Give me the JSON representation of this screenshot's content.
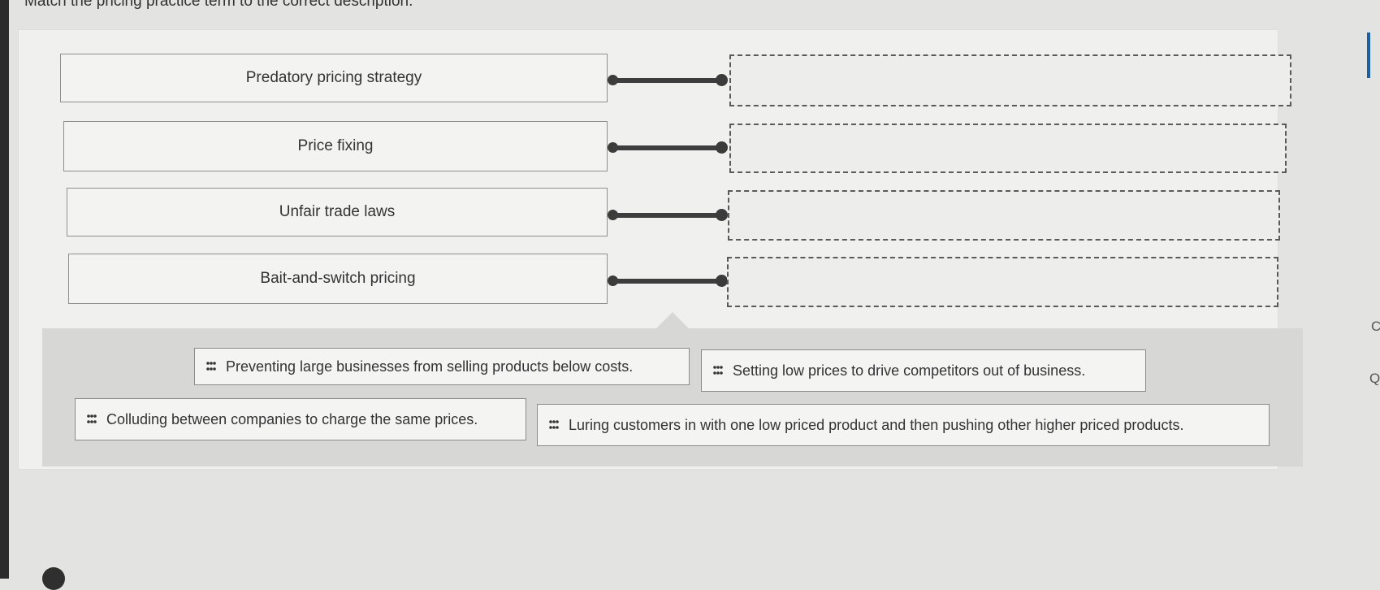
{
  "instruction": "Match the pricing practice term to the correct description.",
  "terms": [
    {
      "label": "Predatory pricing strategy"
    },
    {
      "label": "Price fixing"
    },
    {
      "label": "Unfair trade laws"
    },
    {
      "label": "Bait-and-switch pricing"
    }
  ],
  "answer_bank": [
    {
      "text": "Preventing large businesses from selling products below costs."
    },
    {
      "text": "Setting low prices to drive competitors out of business."
    },
    {
      "text": "Colluding between companies to charge the same prices."
    },
    {
      "text": "Luring customers in with one low priced product and then pushing other higher priced products."
    }
  ],
  "icons": {
    "drag_handle": "drag-grip-icon",
    "connector": "connector-bar-icon"
  },
  "side_letters": [
    "C",
    "Q"
  ]
}
